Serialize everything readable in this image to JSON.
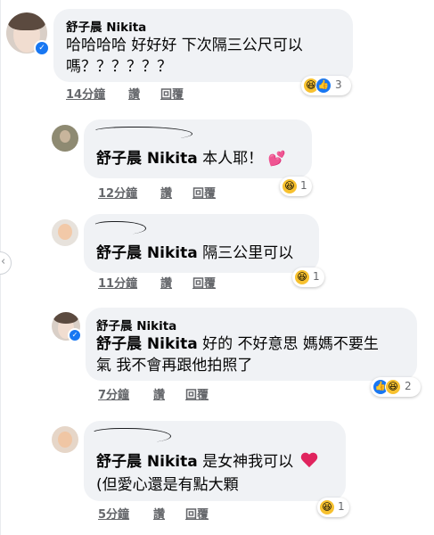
{
  "comments": [
    {
      "name": "舒子晨 Nikita",
      "line1": "哈哈哈哈 好好好 下次隔三公尺可以",
      "line2": "嗎？？？？？？",
      "time": "14分鐘",
      "like": "讚",
      "reply": "回覆",
      "reaction_count": "3",
      "reactions": [
        "haha-icon",
        "like-icon"
      ]
    },
    {
      "tag": "舒子晨 Nikita",
      "text": "本人耶！",
      "emoji": "💕",
      "time": "12分鐘",
      "like": "讚",
      "reply": "回覆",
      "reaction_count": "1",
      "reactions": [
        "haha-icon"
      ]
    },
    {
      "tag": "舒子晨 Nikita",
      "text": "隔三公里可以",
      "time": "11分鐘",
      "like": "讚",
      "reply": "回覆",
      "reaction_count": "1",
      "reactions": [
        "haha-icon"
      ]
    },
    {
      "name": "舒子晨 Nikita",
      "tag": "舒子晨 Nikita",
      "line1": "好的 不好意思 媽媽不要生",
      "line2": "氣 我不會再跟他拍照了",
      "time": "7分鐘",
      "like": "讚",
      "reply": "回覆",
      "reaction_count": "2",
      "reactions": [
        "like-icon",
        "haha-icon"
      ]
    },
    {
      "tag": "舒子晨 Nikita",
      "line1": "是女神我可以",
      "line2": "(但愛心還是有點大顆",
      "time": "5分鐘",
      "like": "讚",
      "reply": "回覆",
      "reaction_count": "1",
      "reactions": [
        "haha-icon"
      ],
      "emoji": "❤️"
    }
  ],
  "colors": {
    "bubble": "#f0f2f5",
    "meta": "#65676b",
    "verified": "#1877f2",
    "haha": "#f7c12f"
  }
}
